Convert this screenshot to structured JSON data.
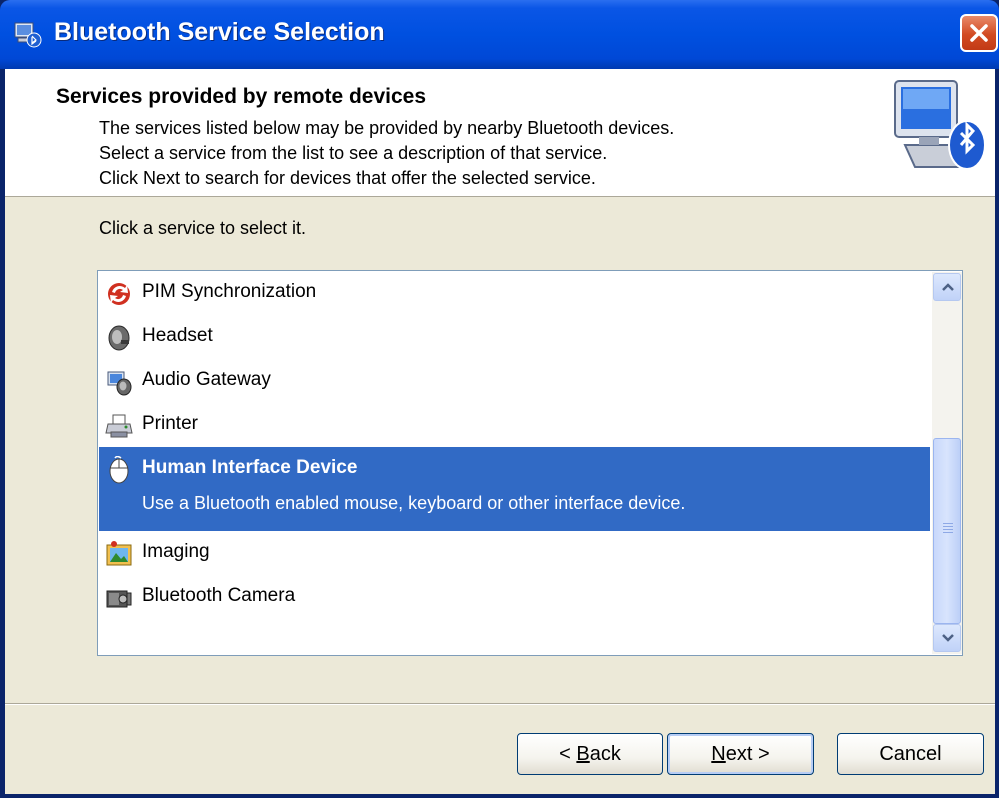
{
  "window": {
    "title": "Bluetooth Service Selection"
  },
  "header": {
    "title": "Services provided by remote devices",
    "lines": [
      "The services listed below may be provided by nearby Bluetooth devices.",
      "Select a service from the list to see a description of that service.",
      "Click Next to search for devices that offer the selected service."
    ],
    "art_icon": "bluetooth-computer-icon"
  },
  "instruction": "Click a service to select it.",
  "services": [
    {
      "label": "PIM Synchronization",
      "icon": "sync-icon"
    },
    {
      "label": "Headset",
      "icon": "headset-icon"
    },
    {
      "label": "Audio Gateway",
      "icon": "audio-gateway-icon"
    },
    {
      "label": "Printer",
      "icon": "printer-icon"
    },
    {
      "label": "Human Interface Device",
      "icon": "mouse-icon",
      "selected": true,
      "description": "Use a Bluetooth enabled mouse, keyboard or other interface device."
    },
    {
      "label": "Imaging",
      "icon": "imaging-icon"
    },
    {
      "label": "Bluetooth Camera",
      "icon": "camera-icon"
    }
  ],
  "buttons": {
    "back": {
      "prefix": "< ",
      "mnemonic": "B",
      "rest": "ack"
    },
    "next": {
      "mnemonic": "N",
      "rest": "ext",
      "suffix": " >"
    },
    "cancel": "Cancel"
  },
  "colors": {
    "selection": "#316ac5",
    "titlebar": "#0050e0",
    "dialog_bg": "#ece9d8"
  }
}
